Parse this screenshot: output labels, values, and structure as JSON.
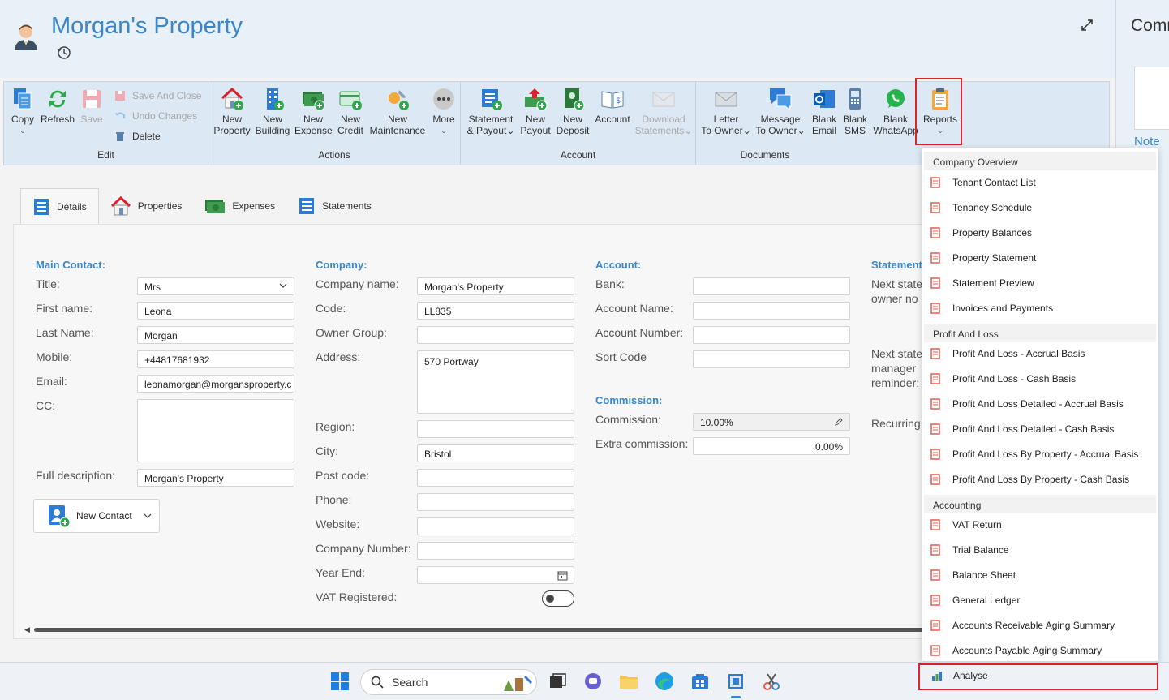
{
  "header": {
    "title": "Morgan's Property"
  },
  "right_panel": {
    "title": "Comr",
    "note_label": "Note"
  },
  "ribbon": {
    "groups": {
      "edit": "Edit",
      "actions": "Actions",
      "account": "Account",
      "documents": "Documents"
    },
    "buttons": {
      "copy": "Copy",
      "refresh": "Refresh",
      "save": "Save",
      "save_and_close": "Save And Close",
      "undo_changes": "Undo Changes",
      "delete": "Delete",
      "new_property_1": "New",
      "new_property_2": "Property",
      "new_building_1": "New",
      "new_building_2": "Building",
      "new_expense_1": "New",
      "new_expense_2": "Expense",
      "new_credit_1": "New",
      "new_credit_2": "Credit",
      "new_maintenance_1": "New",
      "new_maintenance_2": "Maintenance",
      "more": "More",
      "statement_payout_1": "Statement",
      "statement_payout_2": "& Payout",
      "new_payout_1": "New",
      "new_payout_2": "Payout",
      "new_deposit_1": "New",
      "new_deposit_2": "Deposit",
      "account": "Account",
      "download_statements_1": "Download",
      "download_statements_2": "Statements",
      "letter_to_owner_1": "Letter",
      "letter_to_owner_2": "To Owner",
      "message_to_owner_1": "Message",
      "message_to_owner_2": "To Owner",
      "blank_email_1": "Blank",
      "blank_email_2": "Email",
      "blank_sms_1": "Blank",
      "blank_sms_2": "SMS",
      "blank_whatsapp_1": "Blank",
      "blank_whatsapp_2": "WhatsApp",
      "reports": "Reports"
    }
  },
  "tabs": {
    "details": "Details",
    "properties": "Properties",
    "expenses": "Expenses",
    "statements": "Statements"
  },
  "main_contact": {
    "section": "Main Contact:",
    "title_label": "Title:",
    "title_value": "Mrs",
    "first_name_label": "First name:",
    "first_name_value": "Leona",
    "last_name_label": "Last Name:",
    "last_name_value": "Morgan",
    "mobile_label": "Mobile:",
    "mobile_value": "+44817681932",
    "email_label": "Email:",
    "email_value": "leonamorgan@morgansproperty.c",
    "cc_label": "CC:",
    "full_description_label": "Full description:",
    "full_description_value": "Morgan's Property",
    "new_contact": "New Contact"
  },
  "company": {
    "section": "Company:",
    "company_name_label": "Company name:",
    "company_name_value": "Morgan's Property",
    "code_label": "Code:",
    "code_value": "LL835",
    "owner_group_label": "Owner Group:",
    "address_label": "Address:",
    "address_value": "570 Portway",
    "region_label": "Region:",
    "city_label": "City:",
    "city_value": "Bristol",
    "post_code_label": "Post code:",
    "phone_label": "Phone:",
    "website_label": "Website:",
    "company_number_label": "Company Number:",
    "year_end_label": "Year End:",
    "vat_registered_label": "VAT Registered:"
  },
  "account": {
    "section": "Account:",
    "bank_label": "Bank:",
    "account_name_label": "Account Name:",
    "account_number_label": "Account Number:",
    "sort_code_label": "Sort Code",
    "commission_section": "Commission:",
    "commission_label": "Commission:",
    "commission_value": "10.00%",
    "extra_commission_label": "Extra commission:",
    "extra_commission_value": "0.00%"
  },
  "statements_col": {
    "section": "Statement",
    "next_owner_1": "Next state",
    "next_owner_2": "owner no",
    "next_manager_1": "Next state",
    "next_manager_2": "manager",
    "next_manager_3": "reminder:",
    "recurring": "Recurring"
  },
  "reports_menu": {
    "company_overview": "Company Overview",
    "tenant_contact_list": "Tenant Contact List",
    "tenancy_schedule": "Tenancy Schedule",
    "property_balances": "Property Balances",
    "property_statement": "Property Statement",
    "statement_preview": "Statement Preview",
    "invoices_and_payments": "Invoices and Payments",
    "profit_and_loss": "Profit And Loss",
    "pl_accrual": "Profit And Loss - Accrual Basis",
    "pl_cash": "Profit And Loss - Cash Basis",
    "pl_detailed_accrual": "Profit And Loss Detailed - Accrual Basis",
    "pl_detailed_cash": "Profit And Loss Detailed - Cash Basis",
    "pl_property_accrual": "Profit And Loss By Property - Accrual Basis",
    "pl_property_cash": "Profit And Loss By Property - Cash Basis",
    "accounting": "Accounting",
    "vat_return": "VAT Return",
    "trial_balance": "Trial Balance",
    "balance_sheet": "Balance Sheet",
    "general_ledger": "General Ledger",
    "ar_aging": "Accounts Receivable Aging Summary",
    "ap_aging": "Accounts Payable Aging Summary",
    "analyse": "Analyse"
  },
  "taskbar": {
    "search": "Search"
  },
  "colors": {
    "accent": "#3a86c8",
    "highlight": "#d9232e",
    "report_icon": "#e85a4f"
  },
  "icons": [
    "user-avatar-icon",
    "history-icon",
    "expand-icon",
    "copy-icon",
    "refresh-icon",
    "save-icon",
    "house-icon",
    "building-icon",
    "money-icon",
    "credit-icon",
    "maintenance-icon",
    "more-icon",
    "statement-icon",
    "payout-icon",
    "deposit-icon",
    "account-book-icon",
    "envelope-icon",
    "chat-icon",
    "outlook-icon",
    "phone-icon",
    "whatsapp-icon",
    "clipboard-icon",
    "report-doc-icon",
    "analyse-chart-icon",
    "windows-icon",
    "search-icon"
  ]
}
